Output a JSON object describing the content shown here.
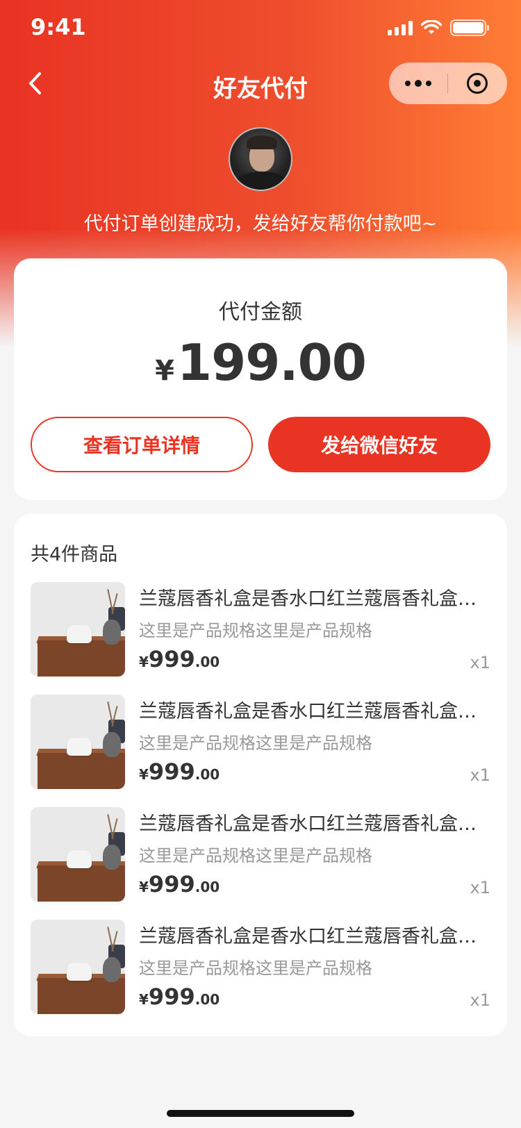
{
  "status_bar": {
    "time": "9:41"
  },
  "nav": {
    "title": "好友代付",
    "back_icon": "chevron-left-icon",
    "more_icon": "more-dots-icon",
    "close_icon": "target-close-icon"
  },
  "hero": {
    "subtitle": "代付订单创建成功，发给好友帮你付款吧~"
  },
  "amount_card": {
    "label": "代付金额",
    "currency": "¥",
    "amount": "199.00",
    "view_order_button": "查看订单详情",
    "send_friend_button": "发给微信好友"
  },
  "goods": {
    "count_text": "共4件商品",
    "items": [
      {
        "title": "兰蔻唇香礼盒是香水口红兰蔻唇香礼盒是香水口红",
        "spec": "这里是产品规格这里是产品规格",
        "currency": "¥",
        "price_int": "999",
        "price_dec": ".00",
        "qty": "x1"
      },
      {
        "title": "兰蔻唇香礼盒是香水口红兰蔻唇香礼盒是香水口红",
        "spec": "这里是产品规格这里是产品规格",
        "currency": "¥",
        "price_int": "999",
        "price_dec": ".00",
        "qty": "x1"
      },
      {
        "title": "兰蔻唇香礼盒是香水口红兰蔻唇香礼盒是香水口红",
        "spec": "这里是产品规格这里是产品规格",
        "currency": "¥",
        "price_int": "999",
        "price_dec": ".00",
        "qty": "x1"
      },
      {
        "title": "兰蔻唇香礼盒是香水口红兰蔻唇香礼盒是香水口红",
        "spec": "这里是产品规格这里是产品规格",
        "currency": "¥",
        "price_int": "999",
        "price_dec": ".00",
        "qty": "x1"
      }
    ]
  },
  "colors": {
    "primary": "#e93323",
    "gradient_end": "#ff7d35",
    "background": "#f5f5f5"
  }
}
